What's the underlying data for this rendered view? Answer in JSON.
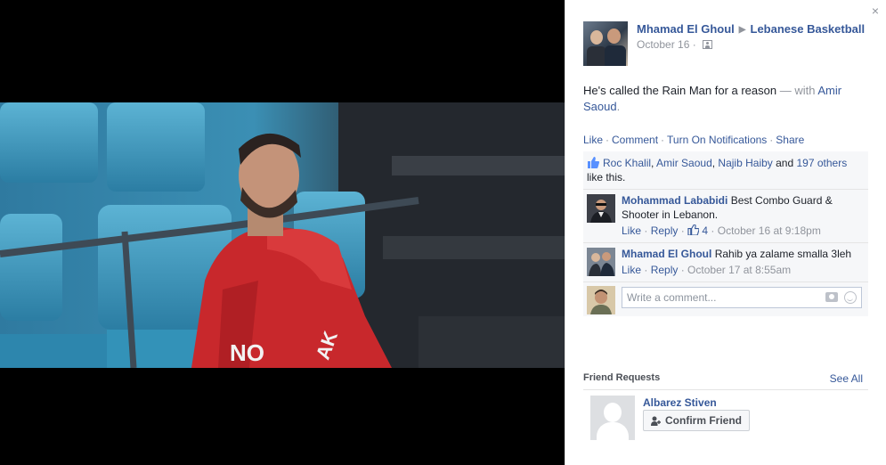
{
  "post": {
    "author": "Mhamad El Ghoul",
    "page": "Lebanese Basketball",
    "date": "October 16",
    "text_main": "He's called the Rain Man for a reason",
    "text_with": " — with ",
    "tagged": "Amir Saoud",
    "text_end": "."
  },
  "actions": {
    "like": "Like",
    "comment": "Comment",
    "notifications": "Turn On Notifications",
    "share": "Share"
  },
  "likes": {
    "names": [
      "Roc Khalil",
      "Amir Saoud",
      "Najib Haiby"
    ],
    "sep1": ", ",
    "sep2": ", ",
    "and": " and ",
    "others": "197 others",
    "suffix": "like this."
  },
  "comments": [
    {
      "author": "Mohammad Lababidi",
      "text": "Best Combo Guard & Shooter in Lebanon.",
      "like": "Like",
      "reply": "Reply",
      "like_count": "4",
      "time": "October 16 at 9:18pm"
    },
    {
      "author": "Mhamad El Ghoul",
      "text": "Rahib ya zalame smalla 3leh",
      "like": "Like",
      "reply": "Reply",
      "time": "October 17 at 8:55am"
    }
  ],
  "reply_box": {
    "placeholder": "Write a comment..."
  },
  "friend_requests": {
    "title": "Friend Requests",
    "see_all": "See All",
    "request": {
      "name": "Albarez Stiven",
      "confirm": "Confirm Friend"
    }
  },
  "close_glyph": "×",
  "colors": {
    "link": "#365899",
    "muted": "#90949c",
    "jersey": "#c8282c"
  }
}
